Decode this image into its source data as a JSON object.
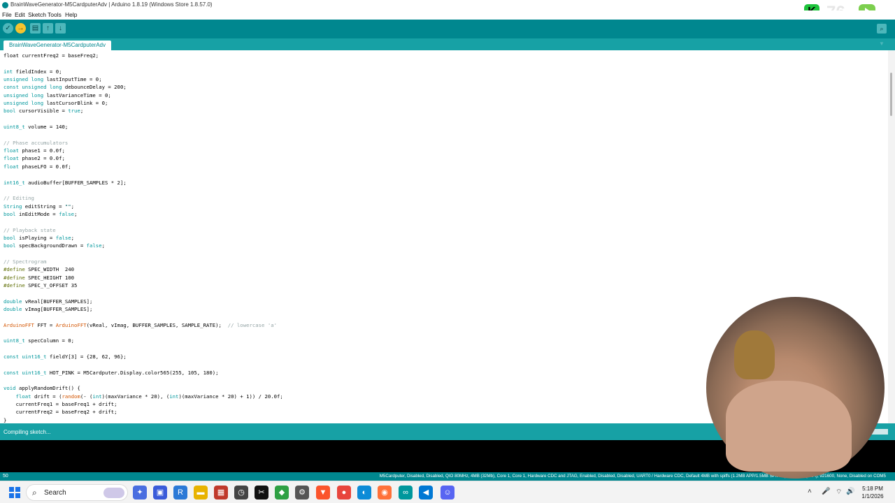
{
  "window": {
    "title": "BrainWaveGenerator-M5CardputerAdv | Arduino 1.8.19 (Windows Store 1.8.57.0)",
    "overlay_number": "76"
  },
  "menu": [
    "File",
    "Edit",
    "Sketch",
    "Tools",
    "Help"
  ],
  "toolbar": {
    "verify": "✓",
    "upload": "→",
    "new": "▤",
    "open": "↑",
    "save": "↓",
    "serial_monitor": "⌕"
  },
  "tab": {
    "label": "BrainWaveGenerator-M5CardputerAdv"
  },
  "code": [
    [
      [
        "",
        "float currentFreq2 = baseFreq2;"
      ]
    ],
    [],
    [
      [
        "kw",
        "int"
      ],
      [
        "",
        " fieldIndex = 0;"
      ]
    ],
    [
      [
        "kw",
        "unsigned long"
      ],
      [
        "",
        " lastInputTime = 0;"
      ]
    ],
    [
      [
        "kw",
        "const unsigned long"
      ],
      [
        "",
        " debounceDelay = 200;"
      ]
    ],
    [
      [
        "kw",
        "unsigned long"
      ],
      [
        "",
        " lastVarianceTime = 0;"
      ]
    ],
    [
      [
        "kw",
        "unsigned long"
      ],
      [
        "",
        " lastCursorBlink = 0;"
      ]
    ],
    [
      [
        "kw",
        "bool"
      ],
      [
        "",
        " cursorVisible = "
      ],
      [
        "kw",
        "true"
      ],
      [
        "",
        ";"
      ]
    ],
    [],
    [
      [
        "kw",
        "uint8_t"
      ],
      [
        "",
        " volume = 140;"
      ]
    ],
    [],
    [
      [
        "cm",
        "// Phase accumulators"
      ]
    ],
    [
      [
        "kw",
        "float"
      ],
      [
        "",
        " phase1 = 0.0f;"
      ]
    ],
    [
      [
        "kw",
        "float"
      ],
      [
        "",
        " phase2 = 0.0f;"
      ]
    ],
    [
      [
        "kw",
        "float"
      ],
      [
        "",
        " phaseLFO = 0.0f;"
      ]
    ],
    [],
    [
      [
        "kw",
        "int16_t"
      ],
      [
        "",
        " audioBuffer[BUFFER_SAMPLES * 2];"
      ]
    ],
    [],
    [
      [
        "cm",
        "// Editing"
      ]
    ],
    [
      [
        "kw",
        "String"
      ],
      [
        "",
        " editString = "
      ],
      [
        "str",
        "\"\""
      ],
      [
        "",
        ";"
      ]
    ],
    [
      [
        "kw",
        "bool"
      ],
      [
        "",
        " inEditMode = "
      ],
      [
        "kw",
        "false"
      ],
      [
        "",
        ";"
      ]
    ],
    [],
    [
      [
        "cm",
        "// Playback state"
      ]
    ],
    [
      [
        "kw",
        "bool"
      ],
      [
        "",
        " isPlaying = "
      ],
      [
        "kw",
        "false"
      ],
      [
        "",
        ";"
      ]
    ],
    [
      [
        "kw",
        "bool"
      ],
      [
        "",
        " specBackgroundDrawn = "
      ],
      [
        "kw",
        "false"
      ],
      [
        "",
        ";"
      ]
    ],
    [],
    [
      [
        "cm",
        "// Spectrogram"
      ]
    ],
    [
      [
        "pp",
        "#define"
      ],
      [
        "",
        " SPEC_WIDTH  240"
      ]
    ],
    [
      [
        "pp",
        "#define"
      ],
      [
        "",
        " SPEC_HEIGHT 100"
      ]
    ],
    [
      [
        "pp",
        "#define"
      ],
      [
        "",
        " SPEC_Y_OFFSET 35"
      ]
    ],
    [],
    [
      [
        "kw",
        "double"
      ],
      [
        "",
        " vReal[BUFFER_SAMPLES];"
      ]
    ],
    [
      [
        "kw",
        "double"
      ],
      [
        "",
        " vImag[BUFFER_SAMPLES];"
      ]
    ],
    [],
    [
      [
        "fn",
        "ArduinoFFT"
      ],
      [
        "",
        " FFT = "
      ],
      [
        "fn",
        "ArduinoFFT"
      ],
      [
        "",
        "(vReal, vImag, BUFFER_SAMPLES, SAMPLE_RATE);  "
      ],
      [
        "cm",
        "// lowercase 'a'"
      ]
    ],
    [],
    [
      [
        "kw",
        "uint8_t"
      ],
      [
        "",
        " specColumn = 0;"
      ]
    ],
    [],
    [
      [
        "kw",
        "const uint16_t"
      ],
      [
        "",
        " fieldY[3] = {28, 62, 96};"
      ]
    ],
    [],
    [
      [
        "kw",
        "const uint16_t"
      ],
      [
        "",
        " HOT_PINK = M5Cardputer.Display.color565(255, 105, 180);"
      ]
    ],
    [],
    [
      [
        "kw",
        "void"
      ],
      [
        "",
        " applyRandomDrift() {"
      ]
    ],
    [
      [
        "",
        "    "
      ],
      [
        "kw",
        "float"
      ],
      [
        "",
        " drift = ("
      ],
      [
        "fn",
        "random"
      ],
      [
        "",
        "(- ("
      ],
      [
        "kw",
        "int"
      ],
      [
        "",
        ")(maxVariance * 20), ("
      ],
      [
        "kw",
        "int"
      ],
      [
        "",
        ")(maxVariance * 20) + 1)) / 20.0f;"
      ]
    ],
    [
      [
        "",
        "    currentFreq1 = baseFreq1 + drift;"
      ]
    ],
    [
      [
        "",
        "    currentFreq2 = baseFreq2 + drift;"
      ]
    ],
    [
      [
        "",
        "}"
      ]
    ]
  ],
  "status": {
    "message": "Compiling sketch..."
  },
  "board": {
    "line_number": "50",
    "info": "M5Cardputer, Disabled, Disabled, QIO 80MHz, 4MB (32Mb), Core 1, Core 1, Hardware CDC and JTAG, Enabled, Disabled, Disabled, UART0 / Hardware CDC, Default 4MB with spiffs (1.2MB APP/1.5MB SPIFFS), 240MHz (WiFi), 921600, None, Disabled on COM5"
  },
  "taskbar": {
    "search_label": "Search",
    "time": "5:18 PM",
    "date": "1/1/2026",
    "icons": [
      {
        "name": "copilot-icon",
        "glyph": "✦",
        "color": "#4a6ee0"
      },
      {
        "name": "store-icon",
        "glyph": "▣",
        "color": "#3a5bd9"
      },
      {
        "name": "remote-icon",
        "glyph": "R",
        "color": "#2b79d6"
      },
      {
        "name": "file-explorer-icon",
        "glyph": "▬",
        "color": "#e8b300"
      },
      {
        "name": "news-icon",
        "glyph": "▦",
        "color": "#c0392b"
      },
      {
        "name": "arduino-clock-icon",
        "glyph": "◷",
        "color": "#444444"
      },
      {
        "name": "capcut-icon",
        "glyph": "✂",
        "color": "#111111"
      },
      {
        "name": "gem-icon",
        "glyph": "◆",
        "color": "#2ea043"
      },
      {
        "name": "settings-icon",
        "glyph": "⚙",
        "color": "#555555"
      },
      {
        "name": "brave-icon",
        "glyph": "▼",
        "color": "#fb542b"
      },
      {
        "name": "chrome-icon",
        "glyph": "●",
        "color": "#e8453c"
      },
      {
        "name": "edge-icon",
        "glyph": "◐",
        "color": "#0c8bd7"
      },
      {
        "name": "firefox-icon",
        "glyph": "◉",
        "color": "#ff7139"
      },
      {
        "name": "arduino-icon",
        "glyph": "∞",
        "color": "#00979c"
      },
      {
        "name": "vscode-icon",
        "glyph": "◀",
        "color": "#0078d4"
      },
      {
        "name": "discord-icon",
        "glyph": "☺",
        "color": "#5865f2"
      }
    ],
    "tray": {
      "chevron": "˄",
      "mic": "🎤",
      "wifi": "⌔",
      "volume": "🔊",
      "battery": "▭"
    }
  }
}
